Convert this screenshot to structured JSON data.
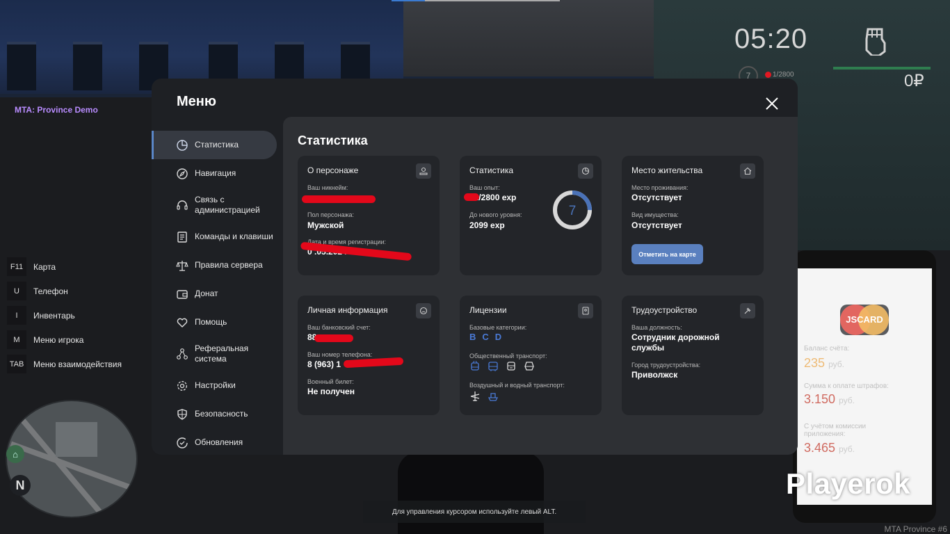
{
  "hud": {
    "server_name": "MTA: Province Demo",
    "server_footer": "MTA Province #6",
    "time": "05:20",
    "level": "7",
    "exp": "1/2800",
    "money": "0₽",
    "alt_hint": "Для управления курсором используйте левый ALT.",
    "watermark": "Playerok",
    "minimap_north": "N"
  },
  "hotkeys": [
    {
      "key": "F11",
      "label": "Карта"
    },
    {
      "key": "U",
      "label": "Телефон"
    },
    {
      "key": "I",
      "label": "Инвентарь"
    },
    {
      "key": "M",
      "label": "Меню игрока"
    },
    {
      "key": "TAB",
      "label": "Меню взаимодействия"
    }
  ],
  "phone": {
    "card_name": "JSCARD",
    "balance_label": "Баланс счёта:",
    "balance": "235",
    "fines_label": "Сумма к оплате штрафов:",
    "fines": "3.150",
    "commission_label": "С учётом комиссии приложения:",
    "commission": "3.465",
    "currency": "руб."
  },
  "menu": {
    "title": "Меню",
    "nav": [
      {
        "label": "Статистика",
        "icon": "pie-chart-icon",
        "active": true
      },
      {
        "label": "Навигация",
        "icon": "compass-icon"
      },
      {
        "label": "Связь с администрацией",
        "icon": "headset-icon"
      },
      {
        "label": "Команды и клавиши",
        "icon": "document-icon"
      },
      {
        "label": "Правила сервера",
        "icon": "scales-icon"
      },
      {
        "label": "Донат",
        "icon": "wallet-icon"
      },
      {
        "label": "Помощь",
        "icon": "heart-icon"
      },
      {
        "label": "Реферальная система",
        "icon": "network-icon"
      },
      {
        "label": "Настройки",
        "icon": "gear-icon"
      },
      {
        "label": "Безопасность",
        "icon": "shield-icon"
      },
      {
        "label": "Обновления",
        "icon": "refresh-check-icon"
      }
    ],
    "content_title": "Статистика",
    "cards": {
      "character": {
        "title": "О персонаже",
        "nickname_label": "Ваш никнейм:",
        "gender_label": "Пол персонажа:",
        "gender": "Мужской",
        "regdate_label": "Дата и время регистрации:",
        "regdate_visible": "0 .05.2024 15:",
        "icon": "person-icon"
      },
      "stats": {
        "title": "Статистика",
        "exp_label": "Ваш опыт:",
        "exp": "01/2800 exp",
        "next_label": "До нового уровня:",
        "next": "2099 exp",
        "level": "7",
        "level_progress": 0.25,
        "icon": "pie-chart-icon"
      },
      "residence": {
        "title": "Место жительства",
        "place_label": "Место проживания:",
        "place": "Отсутствует",
        "property_label": "Вид имущества:",
        "property": "Отсутствует",
        "button": "Отметить на карте",
        "icon": "house-icon"
      },
      "personal": {
        "title": "Личная информация",
        "bank_label": "Ваш банковский счет:",
        "bank": "88",
        "phone_label": "Ваш номер телефона:",
        "phone": "8 (963) 1",
        "military_label": "Военный билет:",
        "military": "Не получен",
        "icon": "face-icon"
      },
      "licenses": {
        "title": "Лицензии",
        "base_label": "Базовые категории:",
        "categories": [
          "B",
          "C",
          "D"
        ],
        "public_label": "Общественный транспорт:",
        "public_icons": [
          "trolleybus-icon",
          "bus-icon",
          "tram-icon",
          "train-icon"
        ],
        "air_label": "Воздушный и водный транспорт:",
        "air_icons": [
          "plane-icon",
          "boat-icon"
        ],
        "icon": "id-badge-icon"
      },
      "job": {
        "title": "Трудоустройство",
        "position_label": "Ваша должность:",
        "position": "Сотрудник дорожной службы",
        "city_label": "Город трудоустройства:",
        "city": "Приволжск",
        "icon": "hammer-icon"
      }
    }
  },
  "colors": {
    "accent": "#5a80bf",
    "category": "#4a7ad6",
    "redaction": "#e3081a",
    "panel": "#2e3034",
    "card": "#232529"
  }
}
